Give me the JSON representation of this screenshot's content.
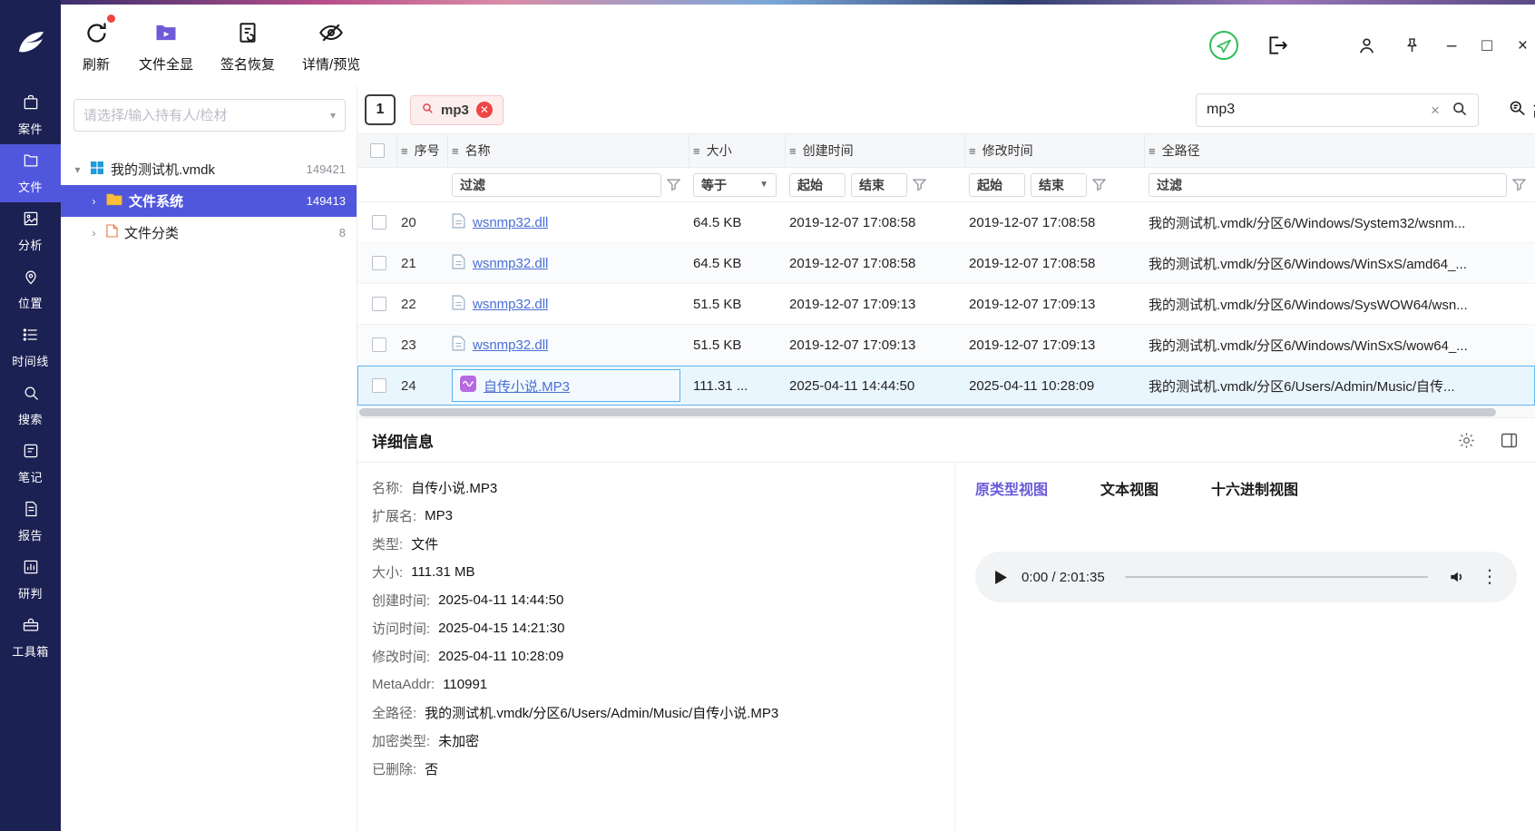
{
  "colors": {
    "accent": "#5157dd",
    "sidebar_bg": "#1c2153",
    "link": "#4a6fd6",
    "active_view_tab": "#6a5ad8",
    "selected_row_border": "#63b8f6",
    "chip_close": "#ee4545",
    "notification_dot": "#f0443f",
    "send_circle": "#2ebd59"
  },
  "sidebar": {
    "items": [
      {
        "label": "案件"
      },
      {
        "label": "文件"
      },
      {
        "label": "分析"
      },
      {
        "label": "位置"
      },
      {
        "label": "时间线"
      },
      {
        "label": "搜索"
      },
      {
        "label": "笔记"
      },
      {
        "label": "报告"
      },
      {
        "label": "研判"
      },
      {
        "label": "工具箱"
      }
    ],
    "active_item": "文件"
  },
  "toolbar": {
    "refresh_label": "刷新",
    "show_all_label": "文件全显",
    "signature_recovery_label": "签名恢复",
    "detail_preview_label": "详情/预览"
  },
  "tree": {
    "picker_placeholder": "请选择/输入持有人/检材",
    "nodes": [
      {
        "label": "我的测试机.vmdk",
        "count": "149421",
        "expanded": true
      },
      {
        "label": "文件系统",
        "count": "149413",
        "selected": true
      },
      {
        "label": "文件分类",
        "count": "8"
      }
    ]
  },
  "tabbar": {
    "page_button": "1",
    "filter_chip": "mp3",
    "search_value": "mp3",
    "advanced_label": "高级"
  },
  "table": {
    "columns": [
      "序号",
      "名称",
      "大小",
      "创建时间",
      "修改时间",
      "全路径"
    ],
    "filter_row": {
      "name_filter": "过滤",
      "size_operator": "等于",
      "created_start": "起始",
      "created_end": "结束",
      "modified_start": "起始",
      "modified_end": "结束",
      "path_filter": "过滤"
    },
    "rows": [
      {
        "num": "20",
        "name": "wsnmp32.dll",
        "size": "64.5 KB",
        "created": "2019-12-07 17:08:58",
        "modified": "2019-12-07 17:08:58",
        "path": "我的测试机.vmdk/分区6/Windows/System32/wsnm..."
      },
      {
        "num": "21",
        "name": "wsnmp32.dll",
        "size": "64.5 KB",
        "created": "2019-12-07 17:08:58",
        "modified": "2019-12-07 17:08:58",
        "path": "我的测试机.vmdk/分区6/Windows/WinSxS/amd64_..."
      },
      {
        "num": "22",
        "name": "wsnmp32.dll",
        "size": "51.5 KB",
        "created": "2019-12-07 17:09:13",
        "modified": "2019-12-07 17:09:13",
        "path": "我的测试机.vmdk/分区6/Windows/SysWOW64/wsn..."
      },
      {
        "num": "23",
        "name": "wsnmp32.dll",
        "size": "51.5 KB",
        "created": "2019-12-07 17:09:13",
        "modified": "2019-12-07 17:09:13",
        "path": "我的测试机.vmdk/分区6/Windows/WinSxS/wow64_..."
      },
      {
        "num": "24",
        "name": "自传小说.MP3",
        "size": "111.31 ...",
        "created": "2025-04-11 14:44:50",
        "modified": "2025-04-11 10:28:09",
        "path": "我的测试机.vmdk/分区6/Users/Admin/Music/自传..."
      }
    ]
  },
  "details": {
    "title": "详细信息",
    "fields": [
      {
        "label": "名称:",
        "value": "自传小说.MP3"
      },
      {
        "label": "扩展名:",
        "value": "MP3"
      },
      {
        "label": "类型:",
        "value": "文件"
      },
      {
        "label": "大小:",
        "value": "111.31 MB"
      },
      {
        "label": "创建时间:",
        "value": "2025-04-11 14:44:50"
      },
      {
        "label": "访问时间:",
        "value": "2025-04-15 14:21:30"
      },
      {
        "label": "修改时间:",
        "value": "2025-04-11 10:28:09"
      },
      {
        "label": "MetaAddr:",
        "value": "110991"
      },
      {
        "label": "全路径:",
        "value": "我的测试机.vmdk/分区6/Users/Admin/Music/自传小说.MP3"
      },
      {
        "label": "加密类型:",
        "value": "未加密"
      },
      {
        "label": "已删除:",
        "value": "否"
      }
    ],
    "view_tabs": [
      {
        "label": "原类型视图",
        "active": true
      },
      {
        "label": "文本视图"
      },
      {
        "label": "十六进制视图"
      }
    ],
    "player": {
      "time": "0:00 / 2:01:35"
    }
  }
}
